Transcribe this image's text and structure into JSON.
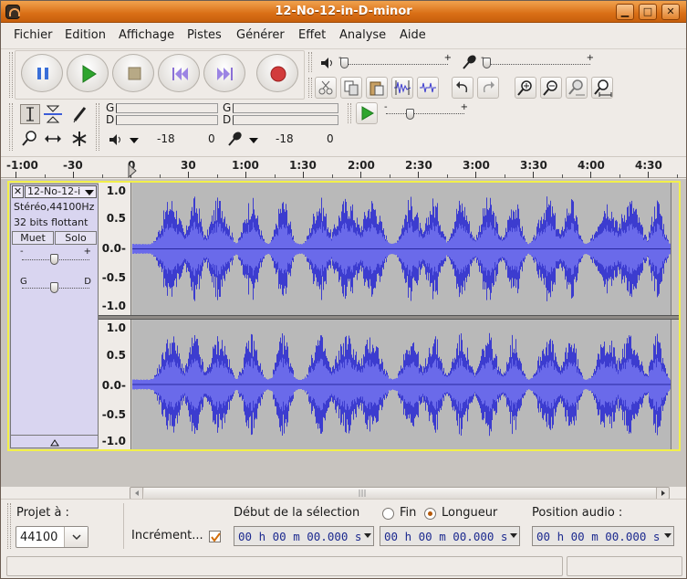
{
  "window": {
    "title": "12-No-12-in-D-minor"
  },
  "menu": {
    "items": [
      {
        "label": "Fichier"
      },
      {
        "label": "Edition"
      },
      {
        "label": "Affichage"
      },
      {
        "label": "Pistes"
      },
      {
        "label": "Générer"
      },
      {
        "label": "Effet"
      },
      {
        "label": "Analyse"
      },
      {
        "label": "Aide"
      }
    ]
  },
  "meter": {
    "left_label": "G",
    "right_label": "D",
    "playback_db_left": "-18",
    "playback_db_right": "0",
    "record_db_left": "-18",
    "record_db_right": "0"
  },
  "ruler": {
    "labels": [
      "-1:00",
      "-30",
      "0",
      "30",
      "1:00",
      "1:30",
      "2:00",
      "2:30",
      "3:00",
      "3:30",
      "4:00",
      "4:30"
    ]
  },
  "track": {
    "name": "12-No-12-i",
    "format": "Stéréo,44100Hz",
    "bit_depth": "32 bits flottant",
    "mute_label": "Muet",
    "solo_label": "Solo",
    "gain_minus": "-",
    "gain_plus": "+",
    "pan_left": "G",
    "pan_right": "D",
    "vruler_top": [
      "1.0",
      "0.5",
      "0.0-",
      "-0.5",
      "-1.0"
    ],
    "vruler_bottom": [
      "1.0",
      "0.5",
      "0.0-",
      "-0.5",
      "-1.0"
    ],
    "wave_color": "#3c3ccf",
    "wave_bg": "#b9b9b9"
  },
  "selection_bar": {
    "project_rate_label": "Projet à :",
    "project_rate_value": "44100",
    "snap_label": "Incrément...",
    "sel_start_label": "Début de la sélection",
    "end_label": "Fin",
    "length_label": "Longueur",
    "audio_pos_label": "Position audio :",
    "sel_start_value": "00 h 00 m 00.000 s",
    "length_value": "00 h 00 m 00.000 s",
    "audio_pos_value": "00 h 00 m 00.000 s"
  }
}
